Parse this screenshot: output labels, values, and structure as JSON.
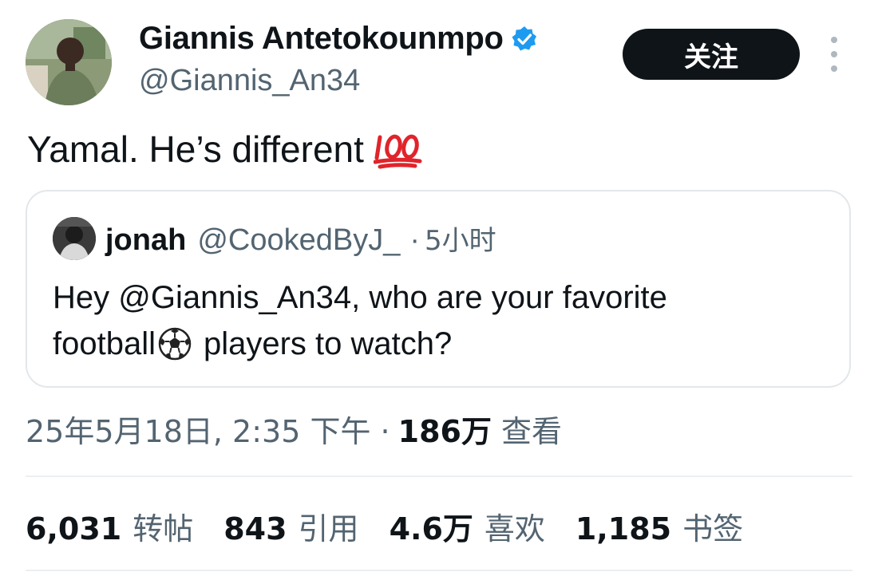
{
  "author": {
    "name": "Giannis Antetokounmpo",
    "handle": "@Giannis_An34",
    "verified": true,
    "verified_color": "#1d9bf0"
  },
  "actions": {
    "follow_label": "关注",
    "more_icon": "more-vertical-icon"
  },
  "tweet": {
    "text": "Yamal. He’s different",
    "emoji": "hundred-points-emoji"
  },
  "quote": {
    "name": "jonah",
    "handle": "@CookedByJ_",
    "separator": "·",
    "time": "5小时",
    "text_line1": "Hey @Giannis_An34, who are your favorite",
    "text_line2_before": "football",
    "text_line2_after": "players to watch?",
    "emoji": "soccer-ball-emoji"
  },
  "meta": {
    "timestamp": "25年5月18日, 2:35 下午 ·",
    "views_count": "186万",
    "views_label": "查看"
  },
  "stats": [
    {
      "count": "6,031",
      "label": "转帖"
    },
    {
      "count": "843",
      "label": "引用"
    },
    {
      "count": "4.6万",
      "label": "喜欢"
    },
    {
      "count": "1,185",
      "label": "书签"
    }
  ],
  "colors": {
    "text_primary": "#0f1419",
    "text_secondary": "#536471",
    "border": "#e3e7ea",
    "button_bg": "#0f1419"
  }
}
